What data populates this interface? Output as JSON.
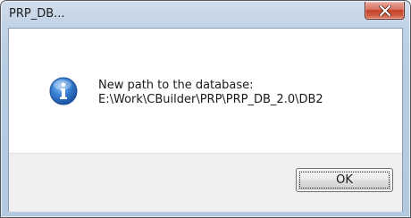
{
  "window": {
    "title": "PRP_DB...",
    "close_icon": "close-icon"
  },
  "message": {
    "icon": "info-icon",
    "line1": "New path to the database:",
    "line2": "E:\\Work\\CBuilder\\PRP\\PRP_DB_2.0\\DB2"
  },
  "buttons": {
    "ok_label": "OK"
  },
  "colors": {
    "title_bar": "#c2d3e6",
    "close_button": "#c6402a",
    "footer": "#f0f0f0",
    "info_icon": "#2b6cc4"
  }
}
